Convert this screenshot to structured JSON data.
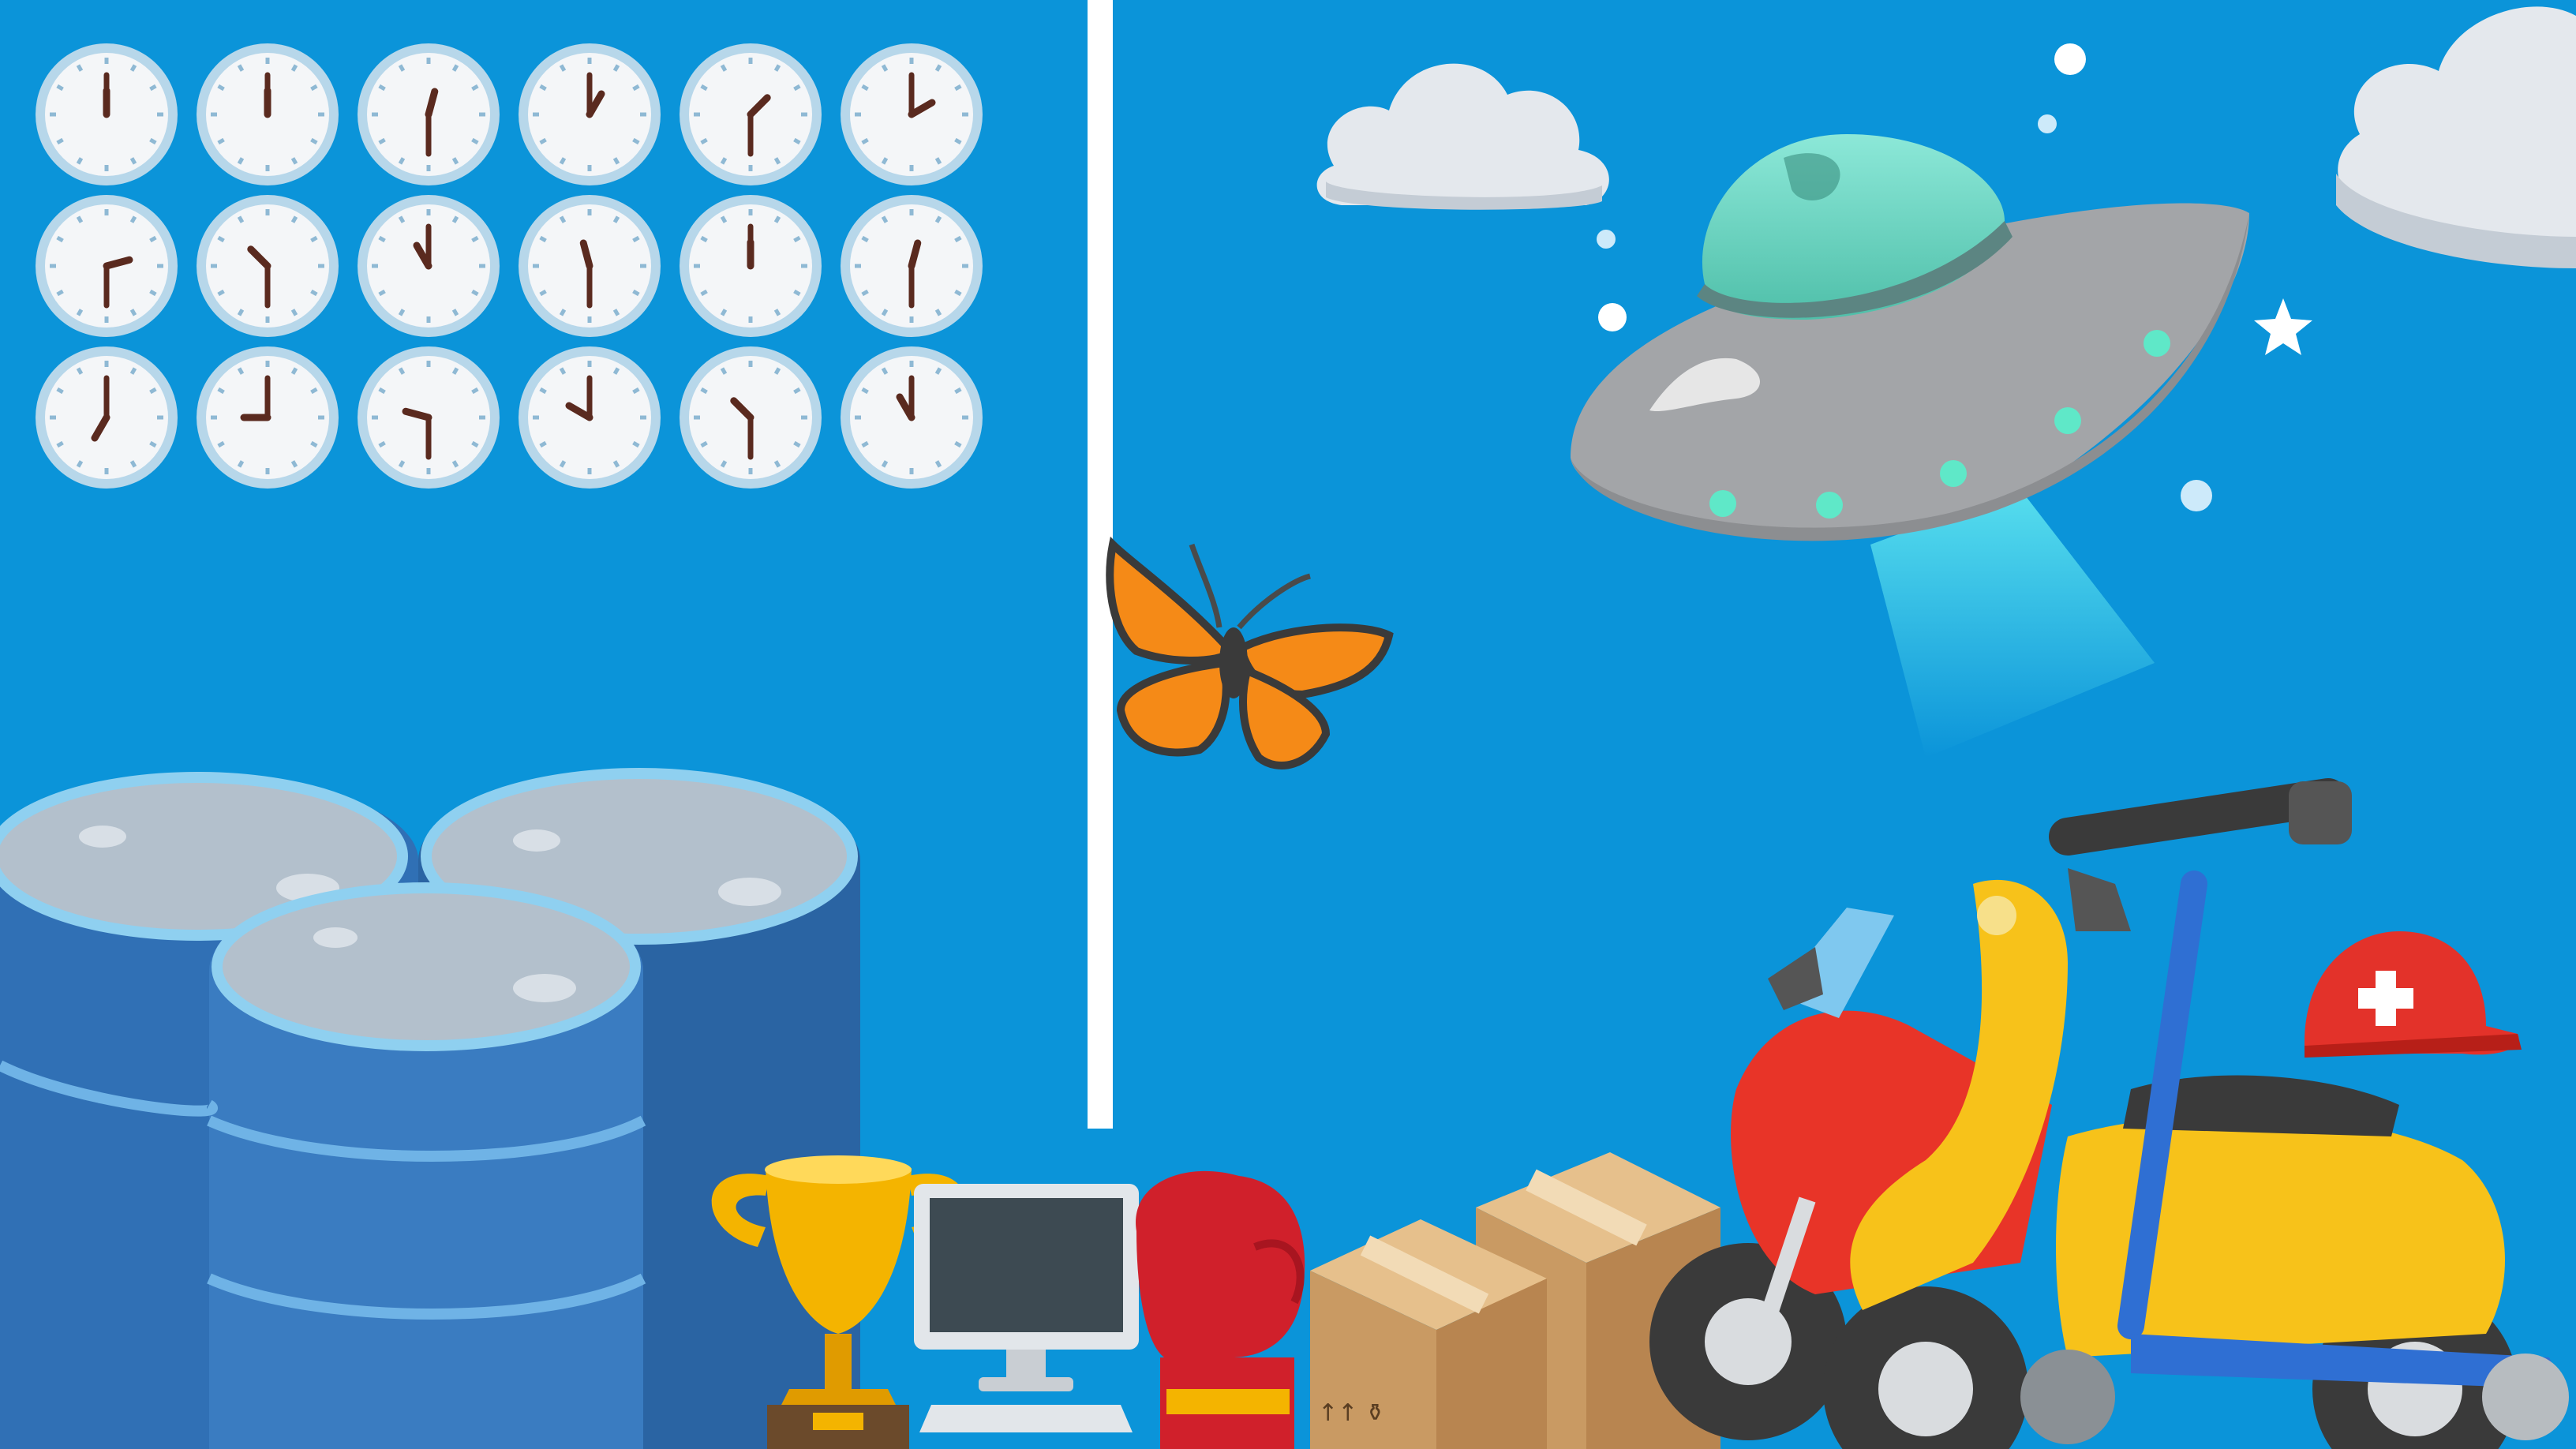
{
  "colors": {
    "background": "#0b94d9",
    "divider": "#ffffff",
    "cloud": "#e4e8ed",
    "ufo_body": "#a3a5a8",
    "ufo_dome": "#6fd6c4",
    "ufo_light": "#5fe8c8",
    "barrel": "#2f6fb3",
    "trophy": "#f4b400",
    "boxing_glove": "#d0202b",
    "box": "#c99a63",
    "motorcycle": "#e83428",
    "scooter": "#f7c21a",
    "kick_scooter": "#2f6fd3",
    "helmet": "#e3322a"
  },
  "clocks": [
    {
      "hour": 12,
      "minute": 0
    },
    {
      "hour": 12,
      "minute": 0
    },
    {
      "hour": 12,
      "minute": 30
    },
    {
      "hour": 1,
      "minute": 0
    },
    {
      "hour": 1,
      "minute": 30
    },
    {
      "hour": 2,
      "minute": 0
    },
    {
      "hour": 2,
      "minute": 30
    },
    {
      "hour": 10,
      "minute": 30
    },
    {
      "hour": 11,
      "minute": 0
    },
    {
      "hour": 11,
      "minute": 30
    },
    {
      "hour": 12,
      "minute": 0
    },
    {
      "hour": 12,
      "minute": 30
    },
    {
      "hour": 7,
      "minute": 0
    },
    {
      "hour": 9,
      "minute": 0
    },
    {
      "hour": 9,
      "minute": 30
    },
    {
      "hour": 10,
      "minute": 0
    },
    {
      "hour": 10,
      "minute": 30
    },
    {
      "hour": 11,
      "minute": 0
    }
  ],
  "icons": {
    "clock": "clock-icon",
    "ufo": "ufo-icon",
    "butterfly": "butterfly-icon",
    "cloud": "cloud-icon",
    "star": "star-icon",
    "barrels": "oil-drum-icon",
    "trophy": "trophy-icon",
    "computer": "desktop-computer-icon",
    "boxing_glove": "boxing-glove-icon",
    "package": "package-icon",
    "motorcycle": "motorcycle-icon",
    "motor_scooter": "motor-scooter-icon",
    "kick_scooter": "kick-scooter-icon",
    "rescue_helmet": "rescue-helmet-icon"
  }
}
